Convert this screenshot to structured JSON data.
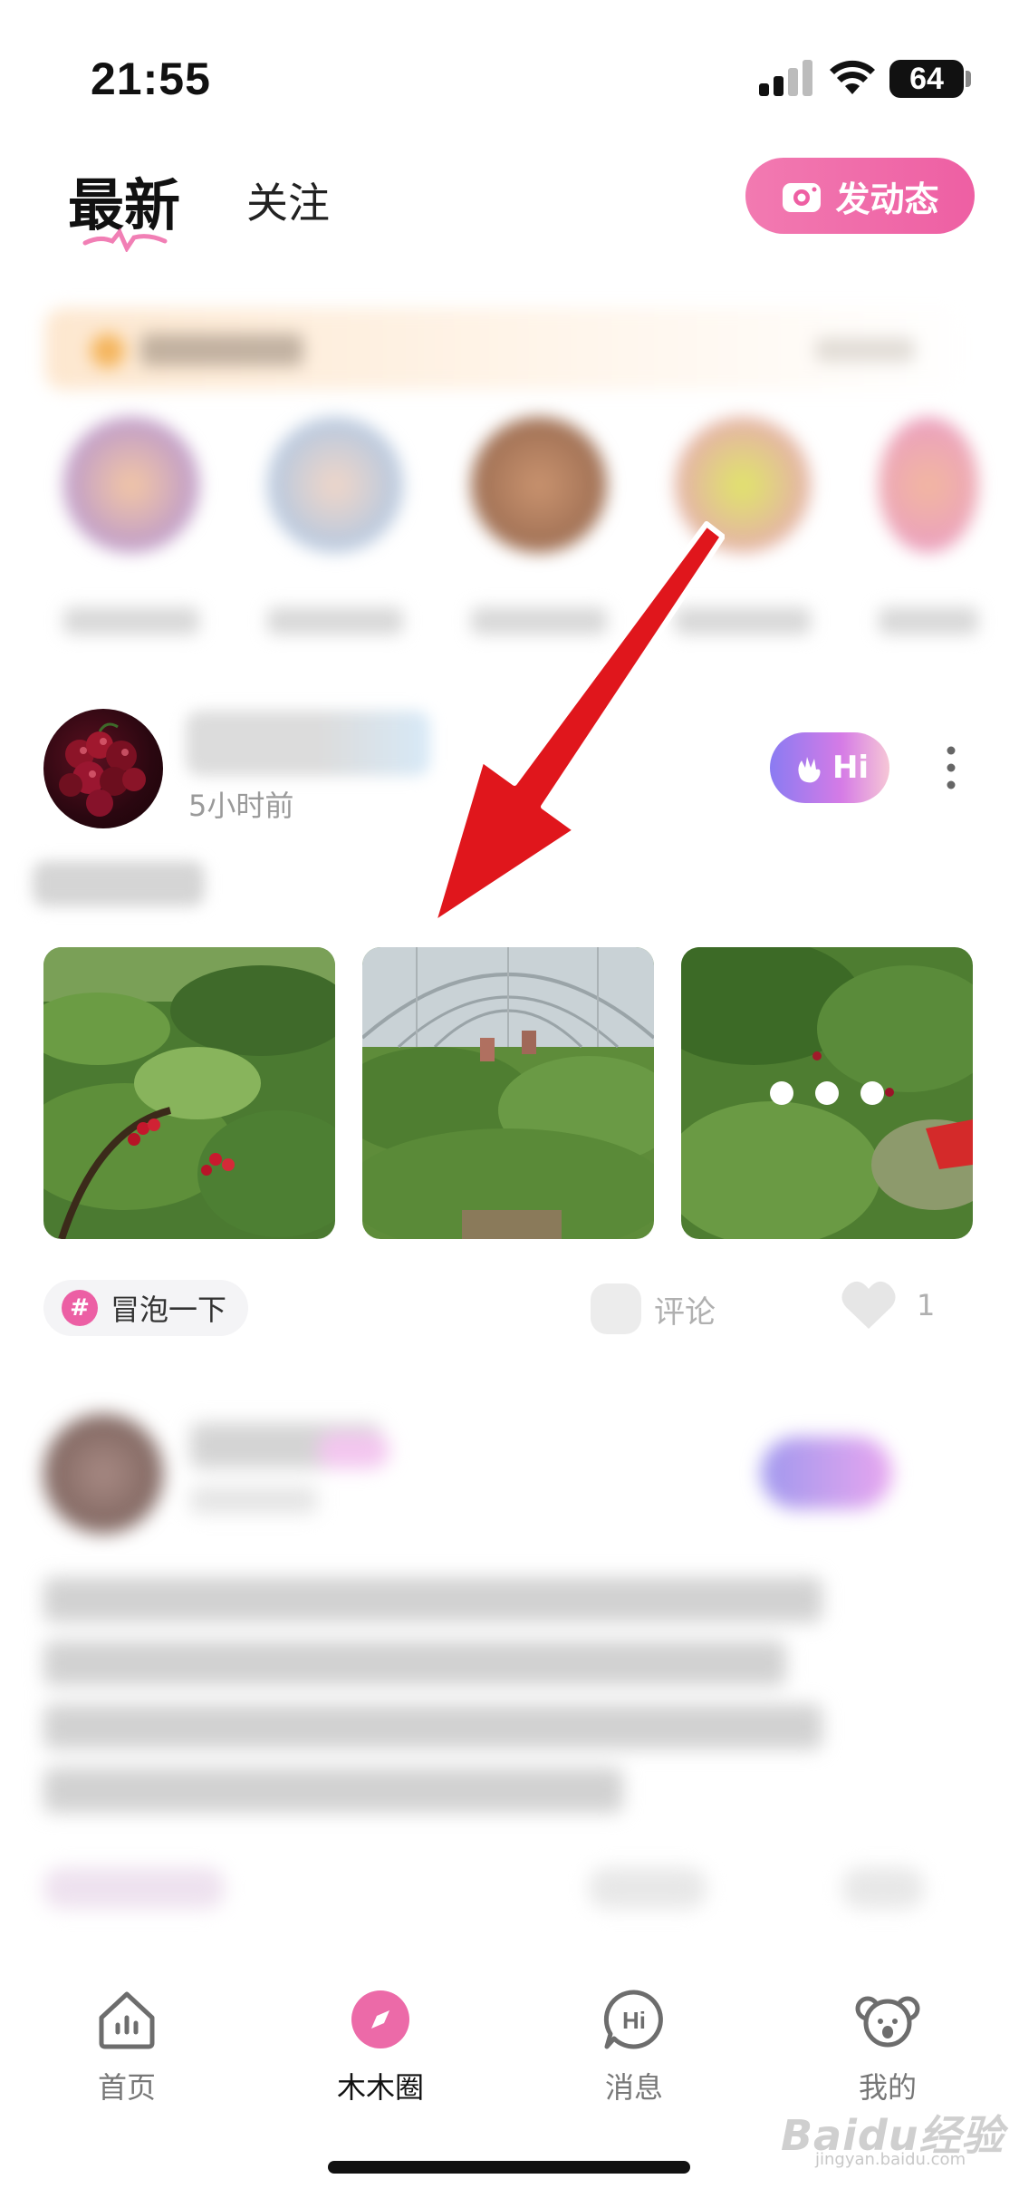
{
  "status_bar": {
    "time": "21:55",
    "battery": "64"
  },
  "header": {
    "tabs": [
      {
        "label": "最新",
        "active": true
      },
      {
        "label": "关注",
        "active": false
      }
    ],
    "post_button_label": "发动态"
  },
  "post": {
    "time_ago": "5小时前",
    "hi_label": "Hi",
    "topic_tag": "冒泡一下",
    "comment_label": "评论",
    "like_count": "1"
  },
  "bottom_nav": [
    {
      "label": "首页",
      "icon": "home-chart-icon",
      "active": false
    },
    {
      "label": "木木圈",
      "icon": "compass-icon",
      "active": true
    },
    {
      "label": "消息",
      "icon": "hi-bubble-icon",
      "active": false
    },
    {
      "label": "我的",
      "icon": "koala-icon",
      "active": false
    }
  ],
  "watermark": {
    "text": "Baidu经验",
    "sub": "jingyan.baidu.com"
  },
  "colors": {
    "accent": "#ee5fa3",
    "arrow": "#e0161c"
  }
}
